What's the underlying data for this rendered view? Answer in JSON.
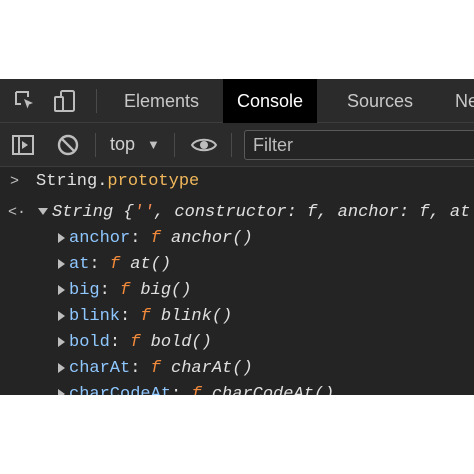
{
  "tabs": [
    {
      "label": "Elements",
      "active": false
    },
    {
      "label": "Console",
      "active": true
    },
    {
      "label": "Sources",
      "active": false
    },
    {
      "label": "Ne",
      "active": false
    }
  ],
  "toolbar": {
    "context": "top",
    "filter_placeholder": "Filter"
  },
  "console": {
    "input": {
      "prompt": ">",
      "object": "String",
      "dot": ".",
      "property": "prototype"
    },
    "result": {
      "prompt": "<·",
      "summary_prefix": "String {",
      "summary_string": "''",
      "summary_rest": ", constructor: f, anchor: f, at"
    },
    "entries": [
      {
        "key": "anchor",
        "fn": "f",
        "signature": "anchor()"
      },
      {
        "key": "at",
        "fn": "f",
        "signature": "at()"
      },
      {
        "key": "big",
        "fn": "f",
        "signature": "big()"
      },
      {
        "key": "blink",
        "fn": "f",
        "signature": "blink()"
      },
      {
        "key": "bold",
        "fn": "f",
        "signature": "bold()"
      },
      {
        "key": "charAt",
        "fn": "f",
        "signature": "charAt()"
      },
      {
        "key": "charCodeAt",
        "fn": "f",
        "signature": "charCodeAt()"
      }
    ]
  },
  "colors": {
    "panel_bg": "#242424",
    "active_tab_bg": "#000000",
    "key": "#8fc7ff",
    "function_keyword": "#f38b3c",
    "property": "#f0b75b"
  },
  "icons": [
    "inspect-element-icon",
    "device-toolbar-icon",
    "sidebar-toggle-icon",
    "clear-console-icon",
    "dropdown-arrow-icon",
    "eye-icon",
    "expand-triangle-icon"
  ]
}
